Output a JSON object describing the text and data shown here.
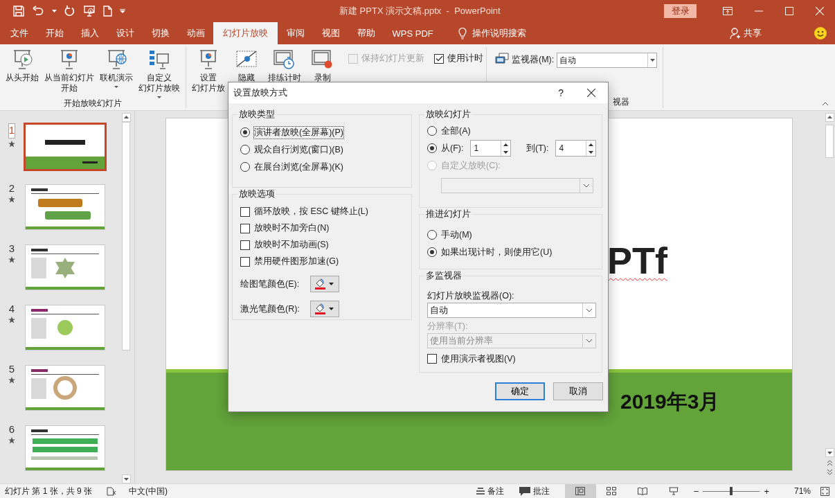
{
  "window": {
    "title": "新建 PPTX 演示文稿.pptx  -  PowerPoint",
    "login": "登录"
  },
  "tabs": [
    {
      "label": "文件",
      "selected": false
    },
    {
      "label": "开始",
      "selected": false
    },
    {
      "label": "插入",
      "selected": false
    },
    {
      "label": "设计",
      "selected": false
    },
    {
      "label": "切换",
      "selected": false
    },
    {
      "label": "动画",
      "selected": false
    },
    {
      "label": "幻灯片放映",
      "selected": true
    },
    {
      "label": "审阅",
      "selected": false
    },
    {
      "label": "视图",
      "selected": false
    },
    {
      "label": "帮助",
      "selected": false
    },
    {
      "label": "WPS PDF",
      "selected": false
    }
  ],
  "tell_me": "操作说明搜索",
  "share": "共享",
  "ribbon": {
    "groups": [
      {
        "label": "开始放映幻灯片",
        "buttons": [
          {
            "kind": "play",
            "lines": [
              "从头开始"
            ],
            "dropdown": false
          },
          {
            "kind": "current",
            "lines": [
              "从当前幻灯片",
              "开始"
            ],
            "dropdown": false
          },
          {
            "kind": "online",
            "lines": [
              "联机演示"
            ],
            "dropdown": true
          },
          {
            "kind": "custom",
            "lines": [
              "自定义",
              "幻灯片放映"
            ],
            "dropdown": true
          }
        ]
      },
      {
        "buttons": [
          {
            "kind": "setup",
            "lines": [
              "设置",
              "幻灯片放"
            ]
          },
          {
            "kind": "hide",
            "lines": [
              "隐藏"
            ]
          },
          {
            "kind": "rehearse",
            "lines": [
              "排练计时"
            ]
          },
          {
            "kind": "record",
            "lines": [
              "录制"
            ]
          }
        ],
        "checks": [
          {
            "label": "保持幻灯片更新",
            "checked": false,
            "disabled": true
          },
          {
            "label": "使用计时",
            "checked": true,
            "disabled": false
          }
        ]
      }
    ],
    "monitor": {
      "label": "监视器(M):",
      "value": "自动",
      "group_label": "视器"
    }
  },
  "thumbs": [
    {
      "number": "1",
      "selected": true
    },
    {
      "number": "2",
      "selected": false
    },
    {
      "number": "3",
      "selected": false
    },
    {
      "number": "4",
      "selected": false
    },
    {
      "number": "5",
      "selected": false
    },
    {
      "number": "6",
      "selected": false
    }
  ],
  "slide": {
    "title_fragment": "PTf",
    "date": "2019年3月"
  },
  "dialog": {
    "title": "设置放映方式",
    "help": "?",
    "show_type": {
      "legend": "放映类型",
      "options": [
        {
          "label": "演讲者放映(全屏幕)(P)",
          "selected": true
        },
        {
          "label": "观众自行浏览(窗口)(B)",
          "selected": false
        },
        {
          "label": "在展台浏览(全屏幕)(K)",
          "selected": false
        }
      ]
    },
    "show_options": {
      "legend": "放映选项",
      "checks": [
        {
          "label": "循环放映，按 ESC 键终止(L)",
          "checked": false
        },
        {
          "label": "放映时不加旁白(N)",
          "checked": false
        },
        {
          "label": "放映时不加动画(S)",
          "checked": false
        },
        {
          "label": "禁用硬件图形加速(G)",
          "checked": false
        }
      ],
      "pens": [
        {
          "label": "绘图笔颜色(E):"
        },
        {
          "label": "激光笔颜色(R):"
        }
      ]
    },
    "show_slides": {
      "legend": "放映幻灯片",
      "all": {
        "label": "全部(A)",
        "selected": false
      },
      "range": {
        "label": "从(F):",
        "selected": true,
        "from": "1",
        "to_label": "到(T):",
        "to": "4"
      },
      "custom": {
        "label": "自定义放映(C):",
        "selected": false,
        "disabled": true
      }
    },
    "advance": {
      "legend": "推进幻灯片",
      "options": [
        {
          "label": "手动(M)",
          "selected": false
        },
        {
          "label": "如果出现计时，则使用它(U)",
          "selected": true
        }
      ]
    },
    "monitors": {
      "legend": "多监视器",
      "monitor_label": "幻灯片放映监视器(O):",
      "monitor_value": "自动",
      "resolution_label": "分辨率(T):",
      "resolution_value": "使用当前分辨率",
      "resolution_disabled": true,
      "presenter": {
        "label": "使用演示者视图(V)",
        "checked": false
      }
    },
    "buttons": [
      {
        "label": "确定",
        "default": true
      },
      {
        "label": "取消",
        "default": false
      }
    ]
  },
  "status": {
    "slide_info": "幻灯片 第 1 张，共 9 张",
    "language": "中文(中国)",
    "notes": "备注",
    "comments": "批注",
    "views": [
      {
        "selected": true
      },
      {
        "selected": false
      },
      {
        "selected": false
      },
      {
        "selected": false
      }
    ],
    "zoom_out": "−",
    "zoom_in": "+",
    "zoom": {
      "level": 0.5,
      "reading": "71%"
    }
  }
}
